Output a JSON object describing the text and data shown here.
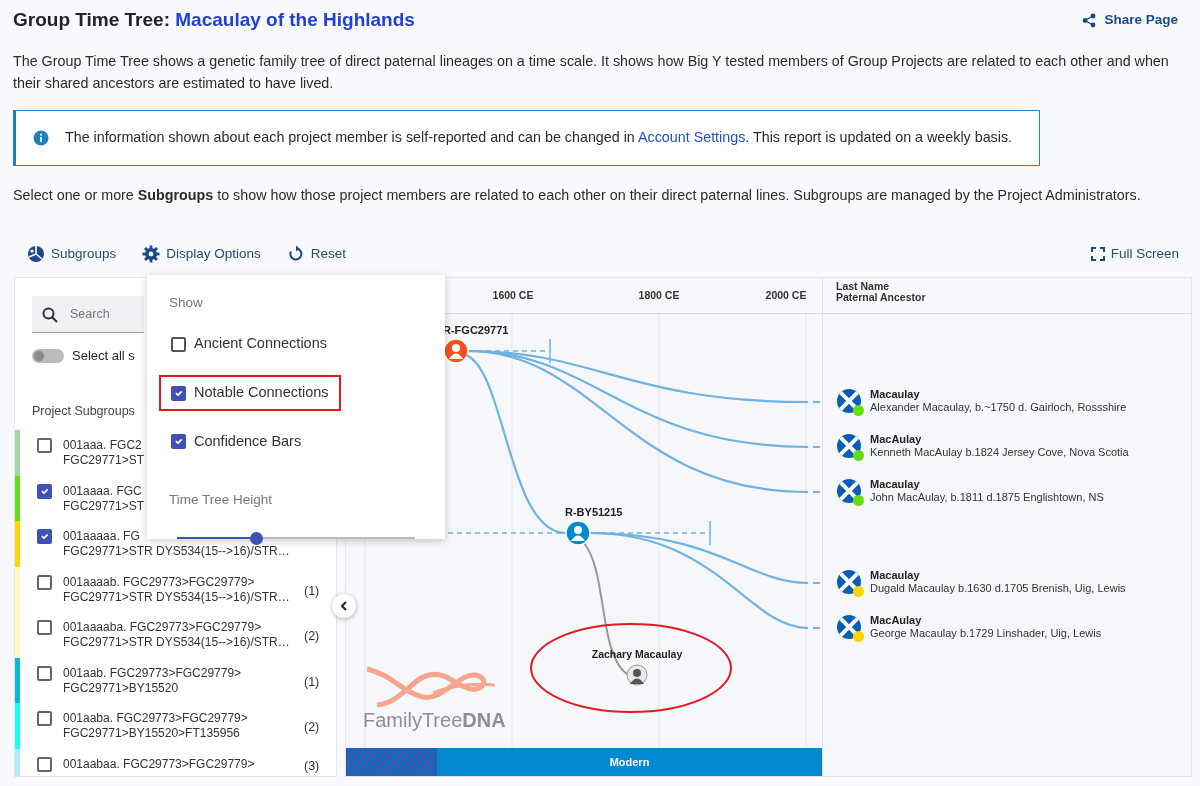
{
  "header": {
    "title": "Group Time Tree:",
    "project": "Macaulay of the Highlands",
    "share": "Share Page"
  },
  "intro": "The Group Time Tree shows a genetic family tree of direct paternal lineages on a time scale. It shows how Big Y tested members of Group Projects are related to each other and when their shared ancestors are estimated to have lived.",
  "notice": {
    "text": "The information shown about each project member is self-reported and can be changed in",
    "link": "Account Settings",
    "text_after": ". This report is updated on a weekly basis."
  },
  "instruction": "Select one or more **Subgroups** to show how those project members are related to each other on their direct paternal lines. Subgroups are managed by the Project Administrators.",
  "toolbar": [
    {
      "label": "Subgroups",
      "kind": "subgroups"
    },
    {
      "label": "Display Options",
      "kind": "options"
    },
    {
      "label": "Reset",
      "kind": "reset"
    }
  ],
  "full_screen": "Full Screen",
  "sidebar": {
    "search": {
      "placeholder": "Search"
    },
    "select_all": {
      "label": "Select all s",
      "on": false
    },
    "heading": "Project Subgroups",
    "subgroups": [
      {
        "lines": [
          "001aaa. FGC2",
          "FGC29771>ST"
        ],
        "checked": false,
        "color": "#a5d6a7"
      },
      {
        "lines": [
          "001aaaa. FGC",
          "FGC29771>ST"
        ],
        "checked": true,
        "color": "#64dd17"
      },
      {
        "lines": [
          "001aaaaa. FG",
          "FGC29771>STR DYS534(15-->16)/STR…"
        ],
        "checked": true,
        "color": "#ffd600"
      },
      {
        "lines": [
          "001aaaab. FGC29773>FGC29779>",
          "FGC29771>STR DYS534(15-->16)/STR…"
        ],
        "count": "(1)",
        "checked": false,
        "color": "#fff9c4"
      },
      {
        "lines": [
          "001aaaaba. FGC29773>FGC29779>",
          "FGC29771>STR DYS534(15-->16)/STR…"
        ],
        "count": "(2)",
        "checked": false,
        "color": "#fff9c4"
      },
      {
        "lines": [
          "001aab. FGC29773>FGC29779>",
          "FGC29771>BY15520"
        ],
        "count": "(1)",
        "checked": false,
        "color": "#00bcd4"
      },
      {
        "lines": [
          "001aaba. FGC29773>FGC29779>",
          "FGC29771>BY15520>FT135956"
        ],
        "count": "(2)",
        "checked": false,
        "color": "#18ffff"
      },
      {
        "lines": [
          "001aabaa. FGC29773>FGC29779>"
        ],
        "count": "(3)",
        "checked": false,
        "color": "#b2ebf2"
      }
    ]
  },
  "display_options": {
    "heading": "Show",
    "options": [
      {
        "label": "Ancient Connections",
        "kind": "ancient",
        "checked": false,
        "highlighted": false
      },
      {
        "label": "Notable Connections",
        "kind": "notable",
        "checked": true,
        "highlighted": true
      },
      {
        "label": "Confidence Bars",
        "kind": "confidence",
        "checked": true,
        "highlighted": false
      }
    ],
    "height_label": "Time Tree Height",
    "height_slider": {
      "level": 0.33
    }
  },
  "tree": {
    "axis": [
      "1600 CE",
      "1800 CE",
      "2000 CE"
    ],
    "column_headers": [
      "Last Name",
      "Paternal Ancestor"
    ],
    "root": {
      "label": "R-FGC29771",
      "color": "#f4511e",
      "members": [
        {
          "surname": "Macaulay",
          "ancestor": "Alexander Macaulay, b.~1750 d. Gairloch, Rossshire",
          "color": "#64dd17"
        },
        {
          "surname": "MacAulay",
          "ancestor": "Kenneth MacAulay b.1824 Jersey Cove, Nova Scotia",
          "color": "#64dd17"
        },
        {
          "surname": "Macaulay",
          "ancestor": "John MacAulay, b.1811 d.1875 Englishtown, NS",
          "color": "#64dd17"
        }
      ],
      "children": [
        {
          "label": "R-BY51215",
          "color": "#0288d1",
          "members": [
            {
              "surname": "Macaulay",
              "ancestor": "Dugald Macaulay b.1630 d.1705 Brenish, Uig, Lewis",
              "color": "#ffd600"
            },
            {
              "surname": "MacAulay",
              "ancestor": "George Macaulay b.1729 Linshader, Uig, Lewis",
              "color": "#ffd600"
            }
          ],
          "notable": {
            "name": "Zachary Macaulay",
            "highlighted": true
          }
        }
      ]
    },
    "era_bar": "Modern",
    "logo": "FamilyTree**DNA**"
  }
}
